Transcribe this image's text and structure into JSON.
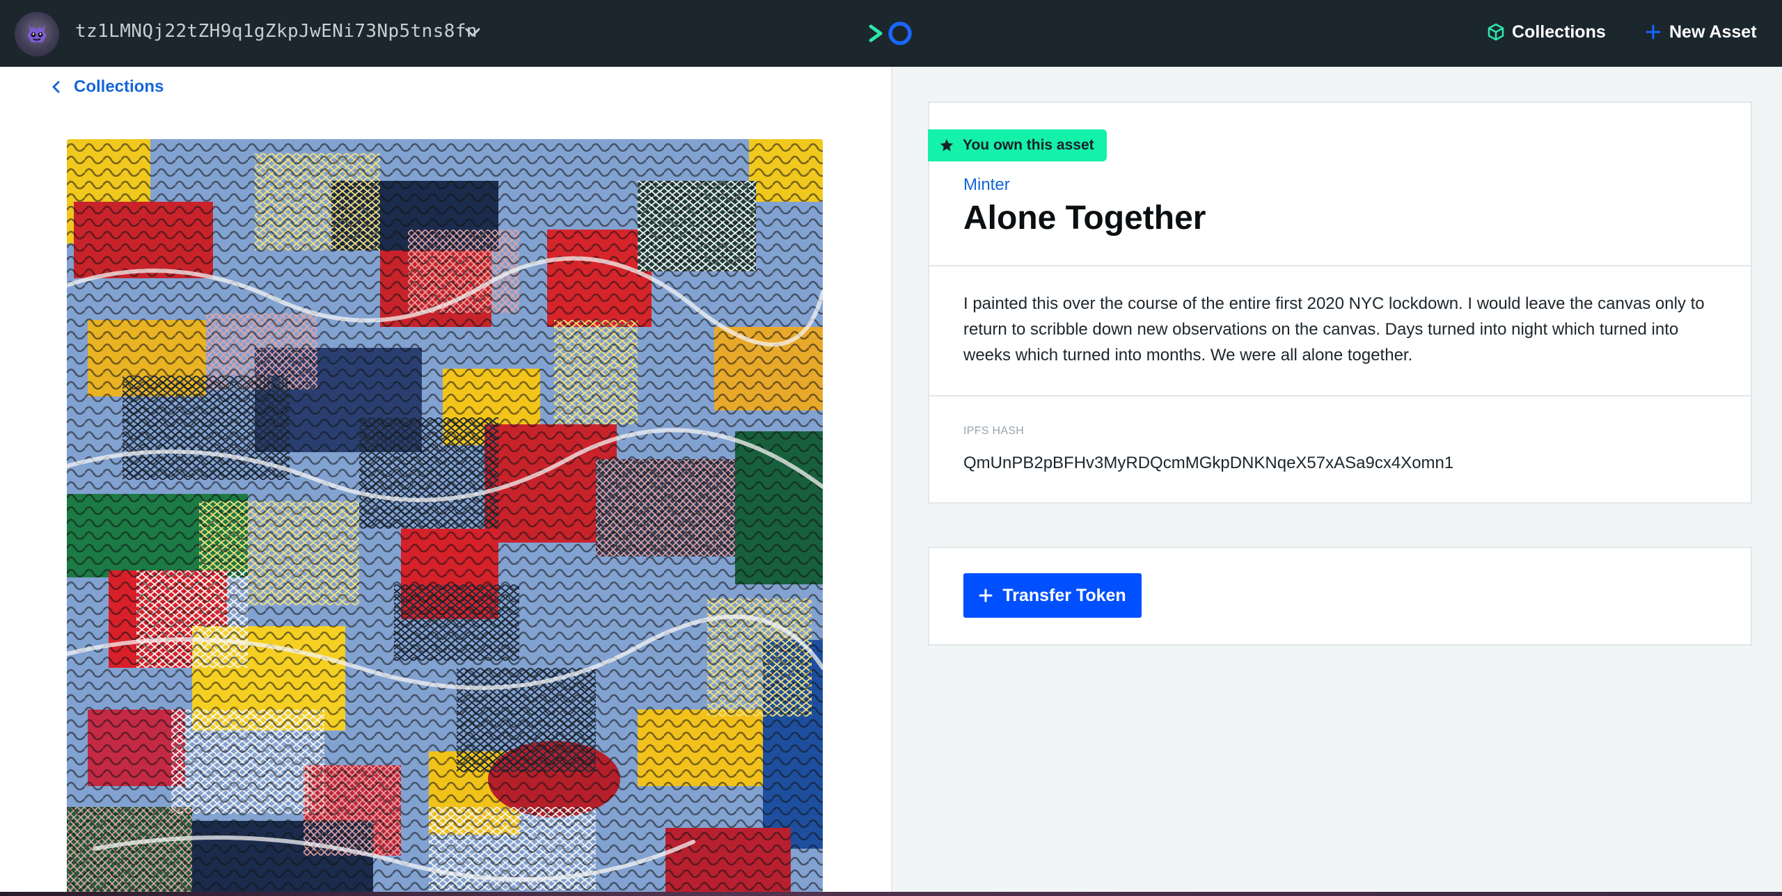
{
  "header": {
    "wallet_address": "tz1LMNQj22tZH9q1gZkpJwENi73Np5tns8fn",
    "icons": {
      "avatar": "robot-avatar",
      "dropdown": "chevron-down-icon",
      "logo": "minter-logo",
      "collections": "cube-icon",
      "new_asset": "plus-icon"
    },
    "nav_collections_label": "Collections",
    "nav_new_asset_label": "New Asset"
  },
  "back_link": {
    "label": "Collections",
    "icon": "chevron-left-icon"
  },
  "asset": {
    "owner_badge_label": "You own this asset",
    "owner_badge_icon": "star-icon",
    "collection_name": "Minter",
    "title": "Alone Together",
    "description": "I painted this over the course of the entire first 2020 NYC lockdown. I would leave the canvas only to return to scribble down new observations on the canvas. Days turned into night which turned into weeks which turned into months. We were all alone together.",
    "ipfs_label": "IPFS HASH",
    "ipfs_hash": "QmUnPB2pBFHv3MyRDQcmMGkpDNKNqeX57xASa9cx4Xomn1",
    "image": "abstract painting"
  },
  "actions": {
    "transfer_label": "Transfer Token",
    "transfer_icon": "plus-icon"
  },
  "colors": {
    "header_bg": "#1b262d",
    "accent_blue": "#0050ff",
    "link_blue": "#1565d8",
    "badge_green": "#14f1a9",
    "logo_green": "#2ee6a8",
    "page_bg": "#f1f5f6"
  }
}
